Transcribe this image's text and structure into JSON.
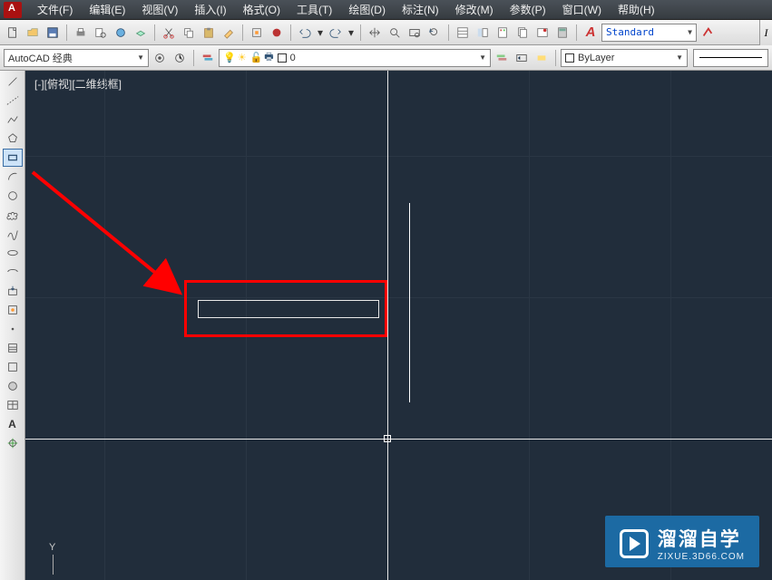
{
  "menubar": {
    "items": [
      {
        "label": "文件(F)"
      },
      {
        "label": "编辑(E)"
      },
      {
        "label": "视图(V)"
      },
      {
        "label": "插入(I)"
      },
      {
        "label": "格式(O)"
      },
      {
        "label": "工具(T)"
      },
      {
        "label": "绘图(D)"
      },
      {
        "label": "标注(N)"
      },
      {
        "label": "修改(M)"
      },
      {
        "label": "参数(P)"
      },
      {
        "label": "窗口(W)"
      },
      {
        "label": "帮助(H)"
      }
    ]
  },
  "toolbar1": {
    "workspace_value": "AutoCAD 经典",
    "text_style_value": "Standard"
  },
  "toolbar2": {
    "layer_value": "0",
    "bylayer_value": "ByLayer"
  },
  "viewport": {
    "label": "[-][俯视][二维线框]"
  },
  "ucs": {
    "y_label": "Y"
  },
  "watermark": {
    "title": "溜溜自学",
    "subtitle": "ZIXUE.3D66.COM"
  },
  "right_edge": {
    "label": "I"
  }
}
